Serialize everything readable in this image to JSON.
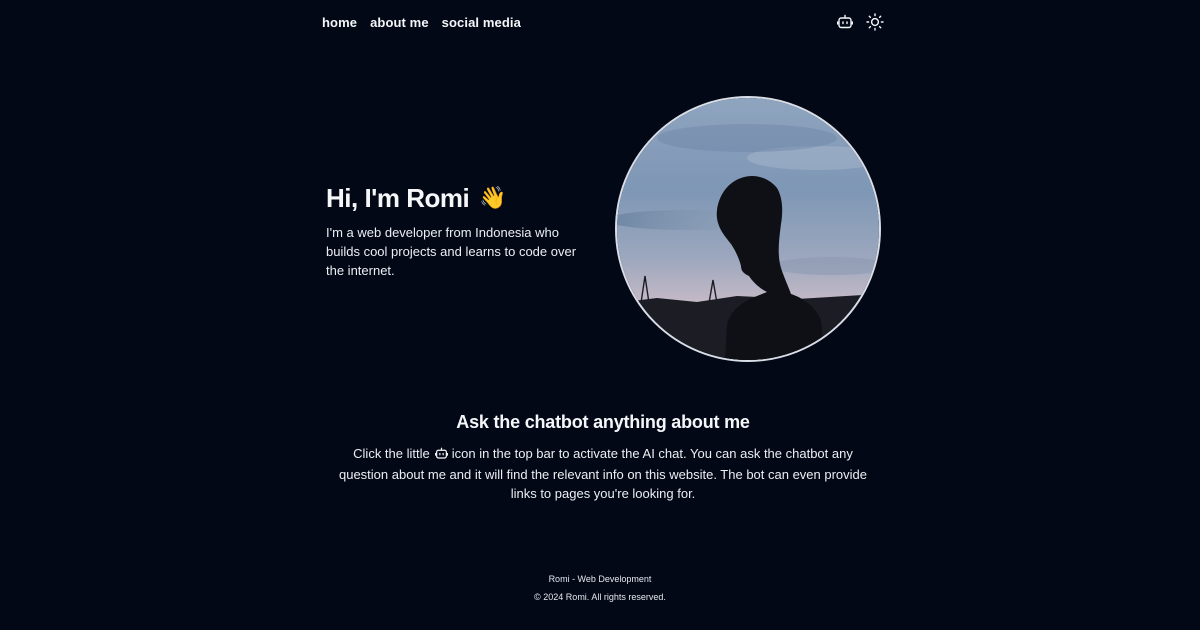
{
  "nav": {
    "links": [
      {
        "label": "home"
      },
      {
        "label": "about me"
      },
      {
        "label": "social media"
      }
    ],
    "chatbot_icon": "robot-icon",
    "theme_icon": "sun-icon"
  },
  "hero": {
    "greeting": "Hi, I'm Romi",
    "emoji": "👋",
    "description": "I'm a web developer from Indonesia who builds cool projects and learns to code over the internet.",
    "avatar_icon": "profile-photo-silhouette"
  },
  "chatbot_section": {
    "title": "Ask the chatbot anything about me",
    "text_before_icon": "Click the little",
    "text_after_icon": "icon in the top bar to activate the AI chat. You can ask the chatbot any question about me and it will find the relevant info on this website. The bot can even provide links to pages you're looking for."
  },
  "footer": {
    "line1": "Romi - Web Development",
    "line2": "© 2024 Romi. All rights reserved."
  },
  "colors": {
    "background": "#030817",
    "text": "#f5f6f8",
    "avatar_border": "#d9dde6"
  }
}
